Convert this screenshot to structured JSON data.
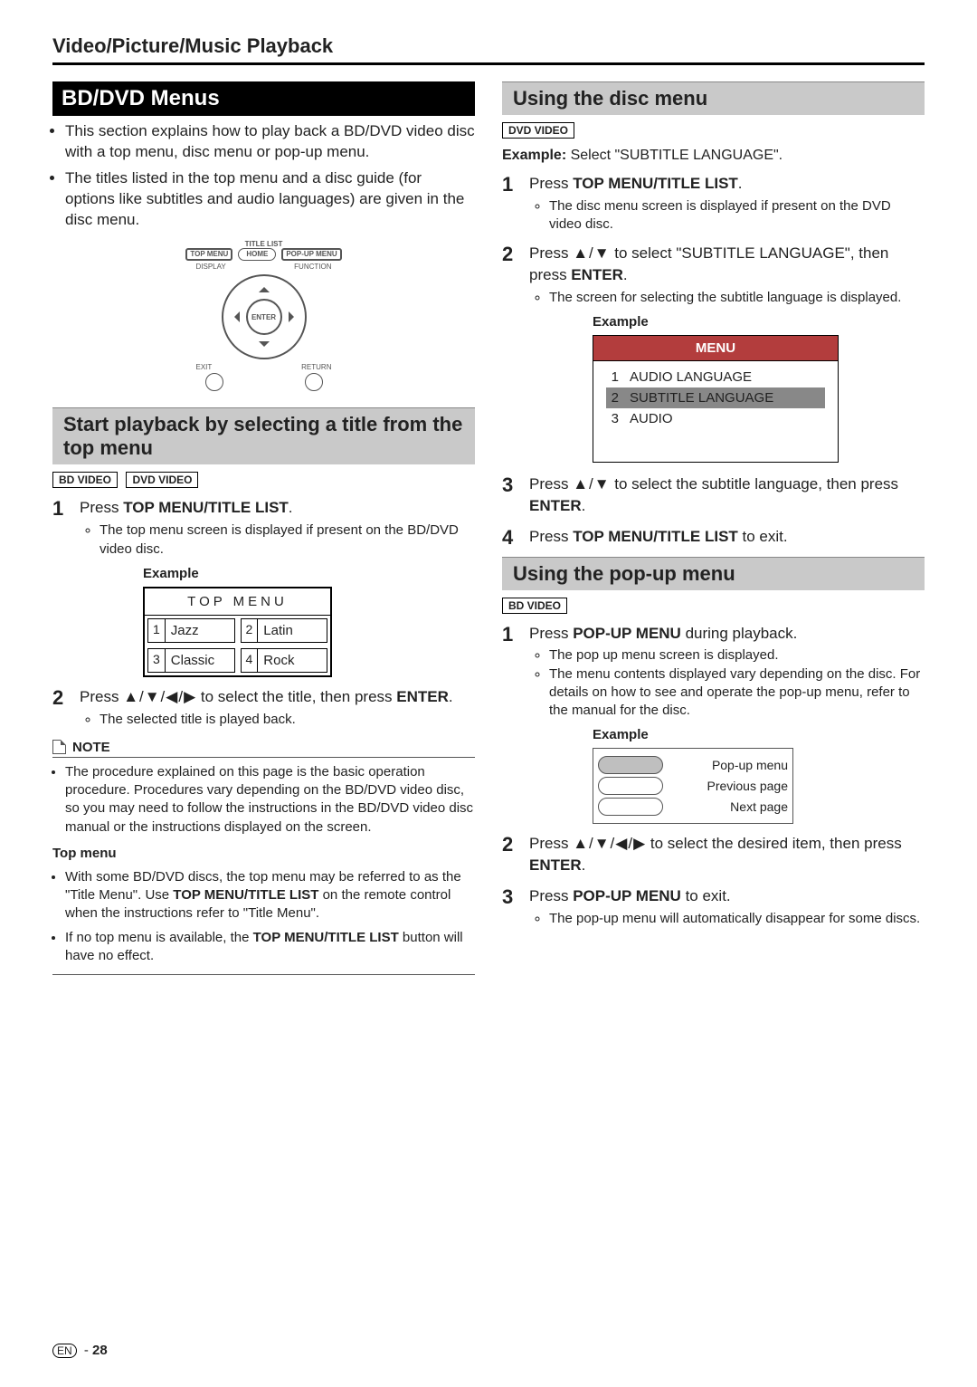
{
  "page_title": "Video/Picture/Music Playback",
  "page_number": "28",
  "lang_marker": "EN",
  "sec_a": {
    "heading": "BD/DVD Menus",
    "intro": [
      "This section explains how to play back a BD/DVD video disc with a top menu, disc menu or pop-up menu.",
      "The titles listed in the top menu and a disc guide (for options like subtitles and audio languages) are given in the disc menu."
    ]
  },
  "remote": {
    "title_list": "TITLE LIST",
    "top_menu": "TOP\nMENU",
    "home": "HOME",
    "popup_menu": "POP-UP\nMENU",
    "display": "DISPLAY",
    "function": "FUNCTION",
    "enter": "ENTER",
    "exit": "EXIT",
    "return": "RETURN"
  },
  "sec_b": {
    "heading": "Start playback by selecting a title from the top menu",
    "badges": [
      "BD VIDEO",
      "DVD VIDEO"
    ],
    "step1_pre": "Press ",
    "step1_bold": "TOP MENU/TITLE LIST",
    "step1_post": ".",
    "step1_sub": "The top menu screen is displayed if present on the BD/DVD video disc.",
    "example_label": "Example",
    "topmenu_title": "TOP MENU",
    "topmenu_items": [
      {
        "n": "1",
        "t": "Jazz"
      },
      {
        "n": "2",
        "t": "Latin"
      },
      {
        "n": "3",
        "t": "Classic"
      },
      {
        "n": "4",
        "t": "Rock"
      }
    ],
    "step2_pre": "Press ",
    "step2_arrows": "▲/▼/◀/▶",
    "step2_mid": " to select the title, then press ",
    "step2_bold": "ENTER",
    "step2_post": ".",
    "step2_sub": "The selected title is played back.",
    "note_label": "NOTE",
    "note_items": [
      "The procedure explained on this page is the basic operation procedure. Procedures vary depending on the BD/DVD video disc, so you may need to follow the instructions in the BD/DVD video disc manual or the instructions displayed on the screen."
    ],
    "topmenu_subhead": "Top menu",
    "topmenu_notes_1_pre": "With some BD/DVD discs, the top menu may be referred to as the \"Title Menu\". Use ",
    "topmenu_notes_1_bold": "TOP MENU/TITLE LIST",
    "topmenu_notes_1_post": " on the remote control when the instructions refer to \"Title Menu\".",
    "topmenu_notes_2_pre": "If no top menu is available, the ",
    "topmenu_notes_2_bold": "TOP MENU/TITLE LIST",
    "topmenu_notes_2_post": " button will have no effect."
  },
  "sec_c": {
    "heading": "Using the disc menu",
    "badges": [
      "DVD VIDEO"
    ],
    "example_intro_bold": "Example:",
    "example_intro_rest": " Select \"SUBTITLE LANGUAGE\".",
    "step1_pre": "Press ",
    "step1_bold": "TOP MENU/TITLE LIST",
    "step1_post": ".",
    "step1_sub": "The disc menu screen is displayed if present on the DVD video disc.",
    "step2_pre": "Press ",
    "step2_arrows": "▲/▼",
    "step2_mid": " to select \"SUBTITLE LANGUAGE\", then press ",
    "step2_bold": "ENTER",
    "step2_post": ".",
    "step2_sub": "The screen for selecting the subtitle language is displayed.",
    "example_label": "Example",
    "menu_title": "MENU",
    "menu_items": [
      {
        "n": "1",
        "t": "AUDIO LANGUAGE",
        "hl": false
      },
      {
        "n": "2",
        "t": "SUBTITLE LANGUAGE",
        "hl": true
      },
      {
        "n": "3",
        "t": "AUDIO",
        "hl": false
      }
    ],
    "step3_pre": "Press ",
    "step3_arrows": "▲/▼",
    "step3_mid": " to select the subtitle language, then press ",
    "step3_bold": "ENTER",
    "step3_post": ".",
    "step4_pre": "Press ",
    "step4_bold": "TOP MENU/TITLE LIST",
    "step4_post": " to exit."
  },
  "sec_d": {
    "heading": "Using the pop-up menu",
    "badges": [
      "BD VIDEO"
    ],
    "step1_pre": "Press ",
    "step1_bold": "POP-UP MENU",
    "step1_post": " during playback.",
    "step1_subs": [
      "The pop up menu screen is displayed.",
      "The menu contents displayed vary depending on the disc. For details on how to see and operate the pop-up menu, refer to the manual for the disc."
    ],
    "example_label": "Example",
    "popup_items": [
      "Pop-up menu",
      "Previous page",
      "Next page"
    ],
    "step2_pre": "Press ",
    "step2_arrows": "▲/▼/◀/▶",
    "step2_mid": " to select the desired item, then press ",
    "step2_bold": "ENTER",
    "step2_post": ".",
    "step3_pre": "Press ",
    "step3_bold": "POP-UP MENU",
    "step3_post": " to exit.",
    "step3_sub": "The pop-up menu will automatically disappear for some discs."
  }
}
